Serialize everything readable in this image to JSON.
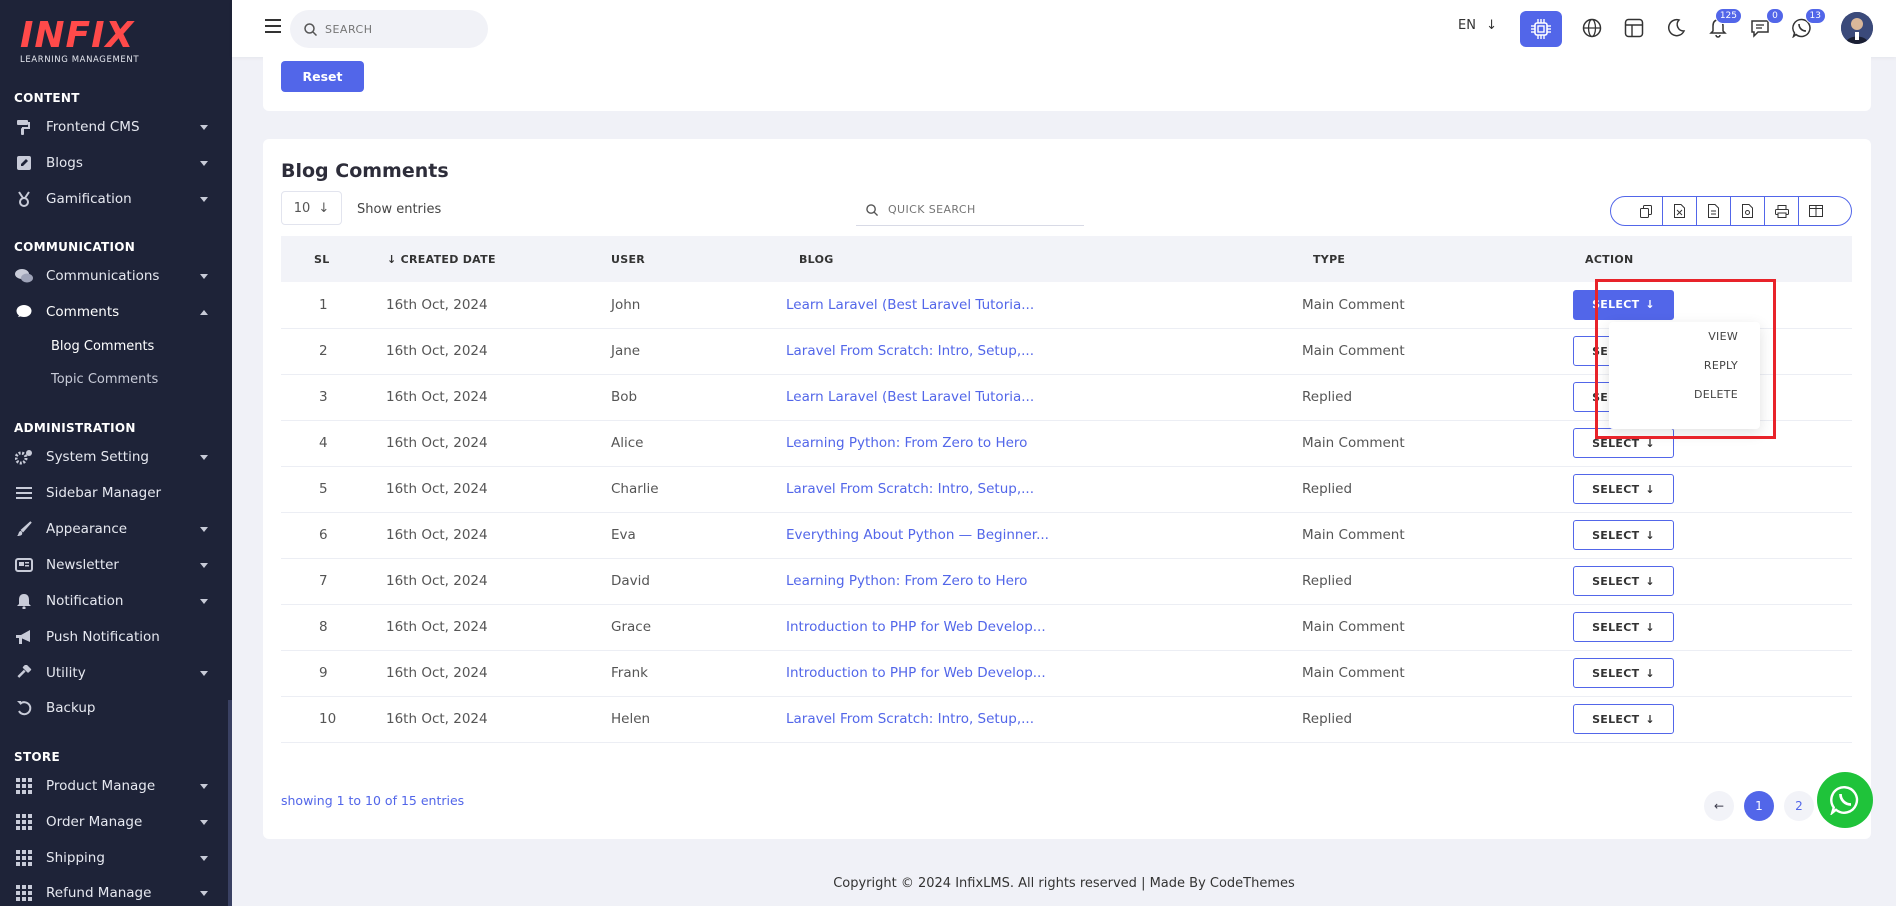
{
  "brand": {
    "logo_text": "INFIX",
    "subtitle": "LEARNING MANAGEMENT",
    "color": "#ff4a4a"
  },
  "sidebar": {
    "sections": [
      {
        "heading": "CONTENT",
        "items": [
          {
            "label": "Frontend CMS",
            "icon": "paint-roller-icon",
            "caret": "down"
          },
          {
            "label": "Blogs",
            "icon": "edit-square-icon",
            "caret": "down"
          },
          {
            "label": "Gamification",
            "icon": "medal-icon",
            "caret": "down"
          }
        ]
      },
      {
        "heading": "COMMUNICATION",
        "items": [
          {
            "label": "Communications",
            "icon": "chat-bubbles-icon",
            "caret": "down"
          },
          {
            "label": "Comments",
            "icon": "comment-icon",
            "caret": "up"
          }
        ]
      },
      {
        "heading": "ADMINISTRATION",
        "items": [
          {
            "label": "System Setting",
            "icon": "gears-icon",
            "caret": "down"
          },
          {
            "label": "Sidebar Manager",
            "icon": "bars-icon"
          },
          {
            "label": "Appearance",
            "icon": "brush-icon",
            "caret": "down"
          },
          {
            "label": "Newsletter",
            "icon": "newsletter-icon",
            "caret": "down"
          },
          {
            "label": "Notification",
            "icon": "bell-icon",
            "caret": "down"
          },
          {
            "label": "Push Notification",
            "icon": "megaphone-icon"
          },
          {
            "label": "Utility",
            "icon": "hammer-icon",
            "caret": "down"
          },
          {
            "label": "Backup",
            "icon": "undo-icon"
          }
        ]
      },
      {
        "heading": "STORE",
        "items": [
          {
            "label": "Product Manage",
            "icon": "grid-icon",
            "caret": "down"
          },
          {
            "label": "Order Manage",
            "icon": "grid-icon",
            "caret": "down"
          },
          {
            "label": "Shipping",
            "icon": "grid-icon",
            "caret": "down"
          },
          {
            "label": "Refund Manage",
            "icon": "grid-icon",
            "caret": "down"
          }
        ]
      }
    ],
    "sub_items": [
      {
        "label": "Blog Comments",
        "active": true
      },
      {
        "label": "Topic Comments",
        "active": false
      }
    ]
  },
  "header": {
    "search_placeholder": "SEARCH",
    "lang": "EN",
    "badges": {
      "notifications": "125",
      "messages": "0",
      "whatsapp": "13"
    }
  },
  "filter": {
    "reset_label": "Reset"
  },
  "table_card": {
    "title": "Blog Comments",
    "entries_value": "10",
    "entries_label": "Show entries",
    "quick_search_placeholder": "QUICK SEARCH",
    "columns": [
      "SL",
      "CREATED DATE",
      "USER",
      "BLOG",
      "TYPE",
      "ACTION"
    ],
    "select_label": "SELECT",
    "rows": [
      {
        "sl": "1",
        "date": "16th Oct, 2024",
        "user": "John",
        "blog": "Learn Laravel (Best Laravel Tutoria...",
        "type": "Main Comment"
      },
      {
        "sl": "2",
        "date": "16th Oct, 2024",
        "user": "Jane",
        "blog": "Laravel From Scratch: Intro, Setup,...",
        "type": "Main Comment"
      },
      {
        "sl": "3",
        "date": "16th Oct, 2024",
        "user": "Bob",
        "blog": "Learn Laravel (Best Laravel Tutoria...",
        "type": "Replied"
      },
      {
        "sl": "4",
        "date": "16th Oct, 2024",
        "user": "Alice",
        "blog": "Learning Python: From Zero to Hero",
        "type": "Main Comment"
      },
      {
        "sl": "5",
        "date": "16th Oct, 2024",
        "user": "Charlie",
        "blog": "Laravel From Scratch: Intro, Setup,...",
        "type": "Replied"
      },
      {
        "sl": "6",
        "date": "16th Oct, 2024",
        "user": "Eva",
        "blog": "Everything About Python — Beginner...",
        "type": "Main Comment"
      },
      {
        "sl": "7",
        "date": "16th Oct, 2024",
        "user": "David",
        "blog": "Learning Python: From Zero to Hero",
        "type": "Replied"
      },
      {
        "sl": "8",
        "date": "16th Oct, 2024",
        "user": "Grace",
        "blog": "Introduction to PHP for Web Develop...",
        "type": "Main Comment"
      },
      {
        "sl": "9",
        "date": "16th Oct, 2024",
        "user": "Frank",
        "blog": "Introduction to PHP for Web Develop...",
        "type": "Main Comment"
      },
      {
        "sl": "10",
        "date": "16th Oct, 2024",
        "user": "Helen",
        "blog": "Laravel From Scratch: Intro, Setup,...",
        "type": "Replied"
      }
    ],
    "dropdown": [
      "VIEW",
      "REPLY",
      "DELETE"
    ],
    "showing": "showing 1 to 10 of 15 entries",
    "pages": [
      "1",
      "2"
    ]
  },
  "footer": {
    "text": "Copyright © 2024 InfixLMS. All rights reserved | Made By CodeThemes"
  },
  "colors": {
    "accent": "#5266e9",
    "sidebar_bg": "#1e2338",
    "highlight": "#e8232a",
    "whatsapp": "#1fc33a"
  }
}
